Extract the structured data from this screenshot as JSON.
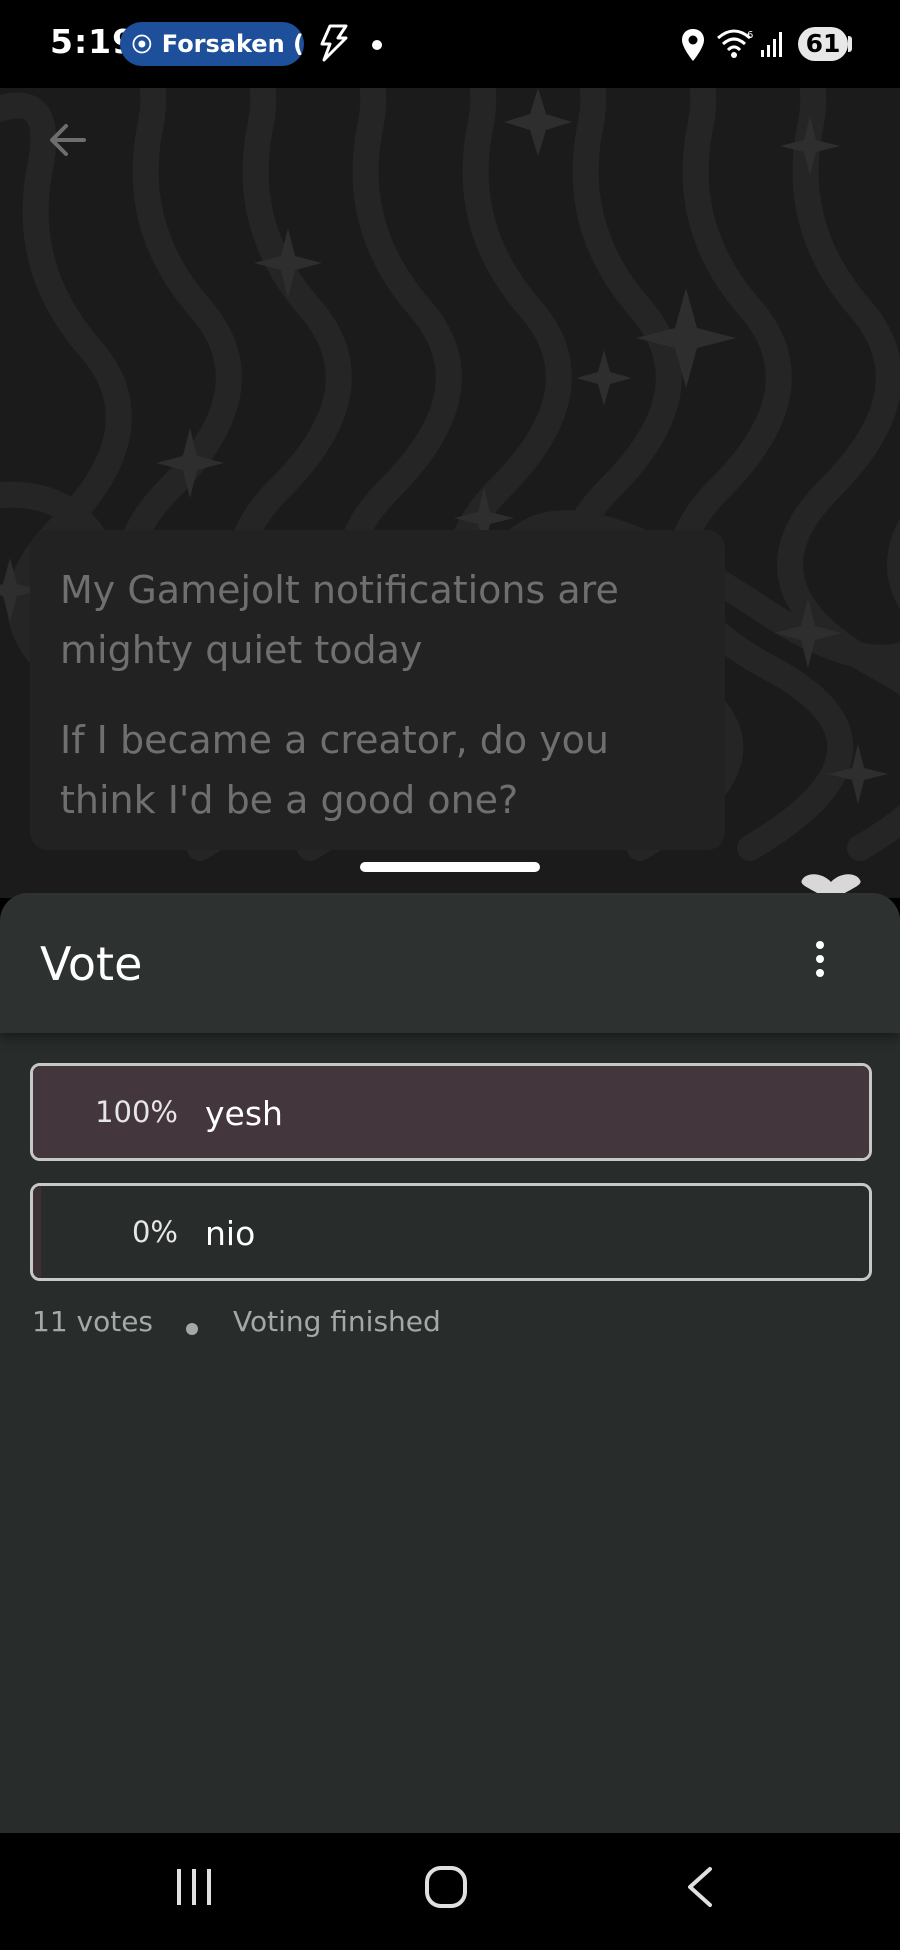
{
  "status_bar": {
    "time": "5:19",
    "media_pill_text": "Forsaken (",
    "battery": "61"
  },
  "post": {
    "text_1": "My Gamejolt notifications are mighty quiet today",
    "text_2": "If I became a creator, do you think I'd be a good one?"
  },
  "sheet": {
    "title": "Vote",
    "options": [
      {
        "percent_label": "100%",
        "label": "yesh",
        "fraction": 1.0
      },
      {
        "percent_label": "0%",
        "label": "nio",
        "fraction": 0.0
      }
    ],
    "votes": "11 votes",
    "status": "Voting finished"
  },
  "colors": {
    "sheet_bg": "#282c2b",
    "header_bg": "#2d3231",
    "winning_fill": "#43363c",
    "option_border": "#c8c8c8",
    "media_pill": "#1d4f9a"
  },
  "icons": [
    "back-arrow-icon",
    "more-vert-icon",
    "play-icon",
    "flash-icon",
    "location-icon",
    "wifi-icon",
    "signal-icon",
    "recents-icon",
    "home-icon",
    "nav-back-icon"
  ]
}
